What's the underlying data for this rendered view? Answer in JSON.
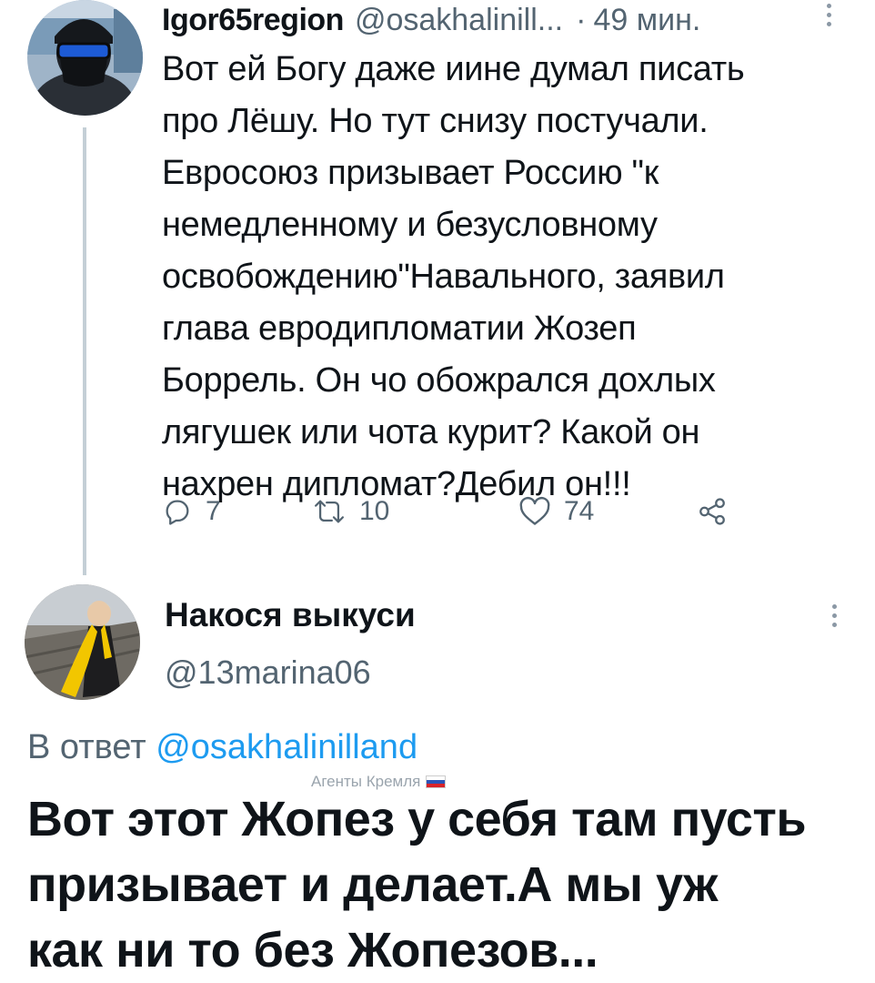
{
  "tweet1": {
    "display_name": "Igor65region",
    "handle": "@osakhalinill...",
    "separator": "·",
    "time": "49 мин.",
    "text": "Вот ей Богу даже иине думал писать\nпро Лёшу. Но тут снизу постучали.\nЕвросоюз призывает Россию \"к\nнемедленному и безусловному\nосвобождению\"Навального, заявил\nглава евродипломатии Жозеп\nБоррель. Он чо обожрался дохлых\nлягушек или чота курит? Какой он\nнахрен дипломат?Дебил он!!!",
    "actions": {
      "replies": "7",
      "retweets": "10",
      "likes": "74"
    }
  },
  "tweet2": {
    "display_name": "Накося выкуси",
    "handle": "@13marina06",
    "reply_prefix": "В ответ",
    "reply_mention": "@osakhalinilland",
    "text": "Вот этот Жопез у себя там пусть\nпризывает и делает.А мы уж\nкак ни то без Жопезов..."
  },
  "watermark": "Агенты Кремля",
  "colors": {
    "text": "#0f1419",
    "secondary": "#536471",
    "link": "#1d9bf0",
    "thread_line": "#c4cfd6"
  },
  "icons": [
    "reply-icon",
    "retweet-icon",
    "like-icon",
    "share-icon",
    "more-icon"
  ]
}
